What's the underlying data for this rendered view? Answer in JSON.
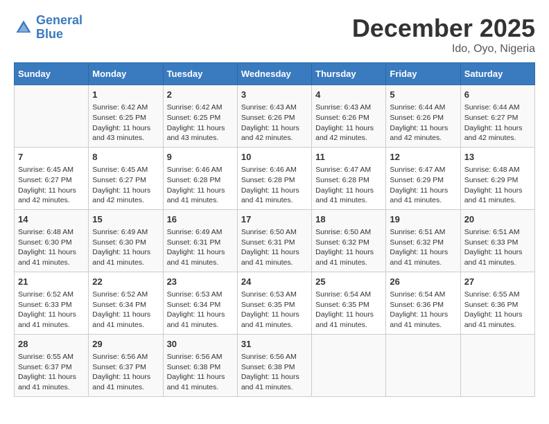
{
  "header": {
    "logo_general": "General",
    "logo_blue": "Blue",
    "month_title": "December 2025",
    "location": "Ido, Oyo, Nigeria"
  },
  "days_of_week": [
    "Sunday",
    "Monday",
    "Tuesday",
    "Wednesday",
    "Thursday",
    "Friday",
    "Saturday"
  ],
  "weeks": [
    [
      {
        "day": "",
        "info": ""
      },
      {
        "day": "1",
        "info": "Sunrise: 6:42 AM\nSunset: 6:25 PM\nDaylight: 11 hours\nand 43 minutes."
      },
      {
        "day": "2",
        "info": "Sunrise: 6:42 AM\nSunset: 6:25 PM\nDaylight: 11 hours\nand 43 minutes."
      },
      {
        "day": "3",
        "info": "Sunrise: 6:43 AM\nSunset: 6:26 PM\nDaylight: 11 hours\nand 42 minutes."
      },
      {
        "day": "4",
        "info": "Sunrise: 6:43 AM\nSunset: 6:26 PM\nDaylight: 11 hours\nand 42 minutes."
      },
      {
        "day": "5",
        "info": "Sunrise: 6:44 AM\nSunset: 6:26 PM\nDaylight: 11 hours\nand 42 minutes."
      },
      {
        "day": "6",
        "info": "Sunrise: 6:44 AM\nSunset: 6:27 PM\nDaylight: 11 hours\nand 42 minutes."
      }
    ],
    [
      {
        "day": "7",
        "info": "Sunrise: 6:45 AM\nSunset: 6:27 PM\nDaylight: 11 hours\nand 42 minutes."
      },
      {
        "day": "8",
        "info": "Sunrise: 6:45 AM\nSunset: 6:27 PM\nDaylight: 11 hours\nand 42 minutes."
      },
      {
        "day": "9",
        "info": "Sunrise: 6:46 AM\nSunset: 6:28 PM\nDaylight: 11 hours\nand 41 minutes."
      },
      {
        "day": "10",
        "info": "Sunrise: 6:46 AM\nSunset: 6:28 PM\nDaylight: 11 hours\nand 41 minutes."
      },
      {
        "day": "11",
        "info": "Sunrise: 6:47 AM\nSunset: 6:28 PM\nDaylight: 11 hours\nand 41 minutes."
      },
      {
        "day": "12",
        "info": "Sunrise: 6:47 AM\nSunset: 6:29 PM\nDaylight: 11 hours\nand 41 minutes."
      },
      {
        "day": "13",
        "info": "Sunrise: 6:48 AM\nSunset: 6:29 PM\nDaylight: 11 hours\nand 41 minutes."
      }
    ],
    [
      {
        "day": "14",
        "info": "Sunrise: 6:48 AM\nSunset: 6:30 PM\nDaylight: 11 hours\nand 41 minutes."
      },
      {
        "day": "15",
        "info": "Sunrise: 6:49 AM\nSunset: 6:30 PM\nDaylight: 11 hours\nand 41 minutes."
      },
      {
        "day": "16",
        "info": "Sunrise: 6:49 AM\nSunset: 6:31 PM\nDaylight: 11 hours\nand 41 minutes."
      },
      {
        "day": "17",
        "info": "Sunrise: 6:50 AM\nSunset: 6:31 PM\nDaylight: 11 hours\nand 41 minutes."
      },
      {
        "day": "18",
        "info": "Sunrise: 6:50 AM\nSunset: 6:32 PM\nDaylight: 11 hours\nand 41 minutes."
      },
      {
        "day": "19",
        "info": "Sunrise: 6:51 AM\nSunset: 6:32 PM\nDaylight: 11 hours\nand 41 minutes."
      },
      {
        "day": "20",
        "info": "Sunrise: 6:51 AM\nSunset: 6:33 PM\nDaylight: 11 hours\nand 41 minutes."
      }
    ],
    [
      {
        "day": "21",
        "info": "Sunrise: 6:52 AM\nSunset: 6:33 PM\nDaylight: 11 hours\nand 41 minutes."
      },
      {
        "day": "22",
        "info": "Sunrise: 6:52 AM\nSunset: 6:34 PM\nDaylight: 11 hours\nand 41 minutes."
      },
      {
        "day": "23",
        "info": "Sunrise: 6:53 AM\nSunset: 6:34 PM\nDaylight: 11 hours\nand 41 minutes."
      },
      {
        "day": "24",
        "info": "Sunrise: 6:53 AM\nSunset: 6:35 PM\nDaylight: 11 hours\nand 41 minutes."
      },
      {
        "day": "25",
        "info": "Sunrise: 6:54 AM\nSunset: 6:35 PM\nDaylight: 11 hours\nand 41 minutes."
      },
      {
        "day": "26",
        "info": "Sunrise: 6:54 AM\nSunset: 6:36 PM\nDaylight: 11 hours\nand 41 minutes."
      },
      {
        "day": "27",
        "info": "Sunrise: 6:55 AM\nSunset: 6:36 PM\nDaylight: 11 hours\nand 41 minutes."
      }
    ],
    [
      {
        "day": "28",
        "info": "Sunrise: 6:55 AM\nSunset: 6:37 PM\nDaylight: 11 hours\nand 41 minutes."
      },
      {
        "day": "29",
        "info": "Sunrise: 6:56 AM\nSunset: 6:37 PM\nDaylight: 11 hours\nand 41 minutes."
      },
      {
        "day": "30",
        "info": "Sunrise: 6:56 AM\nSunset: 6:38 PM\nDaylight: 11 hours\nand 41 minutes."
      },
      {
        "day": "31",
        "info": "Sunrise: 6:56 AM\nSunset: 6:38 PM\nDaylight: 11 hours\nand 41 minutes."
      },
      {
        "day": "",
        "info": ""
      },
      {
        "day": "",
        "info": ""
      },
      {
        "day": "",
        "info": ""
      }
    ]
  ]
}
